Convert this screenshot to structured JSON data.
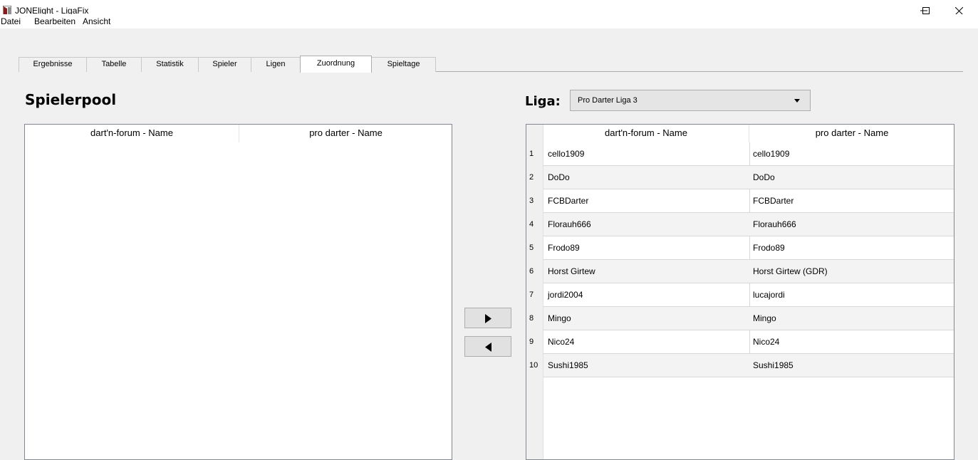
{
  "window": {
    "title": "JONElight - LigaFix"
  },
  "menu": {
    "items": [
      "Datei",
      "Bearbeiten",
      "Ansicht"
    ]
  },
  "tabs": [
    {
      "label": "Ergebnisse"
    },
    {
      "label": "Tabelle"
    },
    {
      "label": "Statistik"
    },
    {
      "label": "Spieler"
    },
    {
      "label": "Ligen"
    },
    {
      "label": "Zuordnung"
    },
    {
      "label": "Spieltage"
    }
  ],
  "active_tab": "Zuordnung",
  "pool": {
    "title": "Spielerpool",
    "columns": [
      "dart'n-forum - Name",
      "pro darter - Name"
    ]
  },
  "liga": {
    "label": "Liga:",
    "selected": "Pro Darter Liga 3",
    "columns": [
      "dart'n-forum - Name",
      "pro darter - Name"
    ],
    "rows": [
      {
        "num": "1",
        "forum": "cello1909",
        "pro": "cello1909"
      },
      {
        "num": "2",
        "forum": "DoDo",
        "pro": "DoDo"
      },
      {
        "num": "3",
        "forum": "FCBDarter",
        "pro": "FCBDarter"
      },
      {
        "num": "4",
        "forum": "Florauh666",
        "pro": "Florauh666"
      },
      {
        "num": "5",
        "forum": "Frodo89",
        "pro": "Frodo89"
      },
      {
        "num": "6",
        "forum": "Horst Girtew",
        "pro": "Horst Girtew (GDR)"
      },
      {
        "num": "7",
        "forum": "jordi2004",
        "pro": "lucajordi"
      },
      {
        "num": "8",
        "forum": "Mingo",
        "pro": "Mingo"
      },
      {
        "num": "9",
        "forum": "Nico24",
        "pro": "Nico24"
      },
      {
        "num": "10",
        "forum": "Sushi1985",
        "pro": "Sushi1985"
      }
    ]
  },
  "icons": {
    "move_right": "triangle-right-icon",
    "move_left": "triangle-left-icon"
  }
}
